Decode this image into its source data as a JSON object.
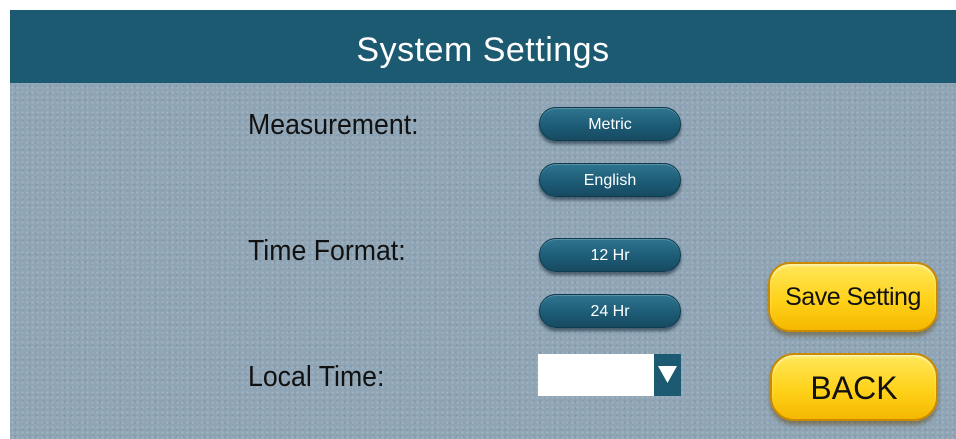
{
  "header": {
    "title": "System Settings"
  },
  "measurement": {
    "label": "Measurement:",
    "options": [
      "Metric",
      "English"
    ]
  },
  "time_format": {
    "label": "Time Format:",
    "options": [
      "12 Hr",
      "24 Hr"
    ]
  },
  "local_time": {
    "label": "Local Time:",
    "value": ""
  },
  "actions": {
    "save_label": "Save Setting",
    "back_label": "BACK"
  },
  "colors": {
    "header": "#1c5a72",
    "background": "#8fa5b5",
    "pill": "#1d5c76",
    "action_button": "#ffd21a"
  },
  "icons": {
    "dropdown": "triangle-down-icon"
  }
}
